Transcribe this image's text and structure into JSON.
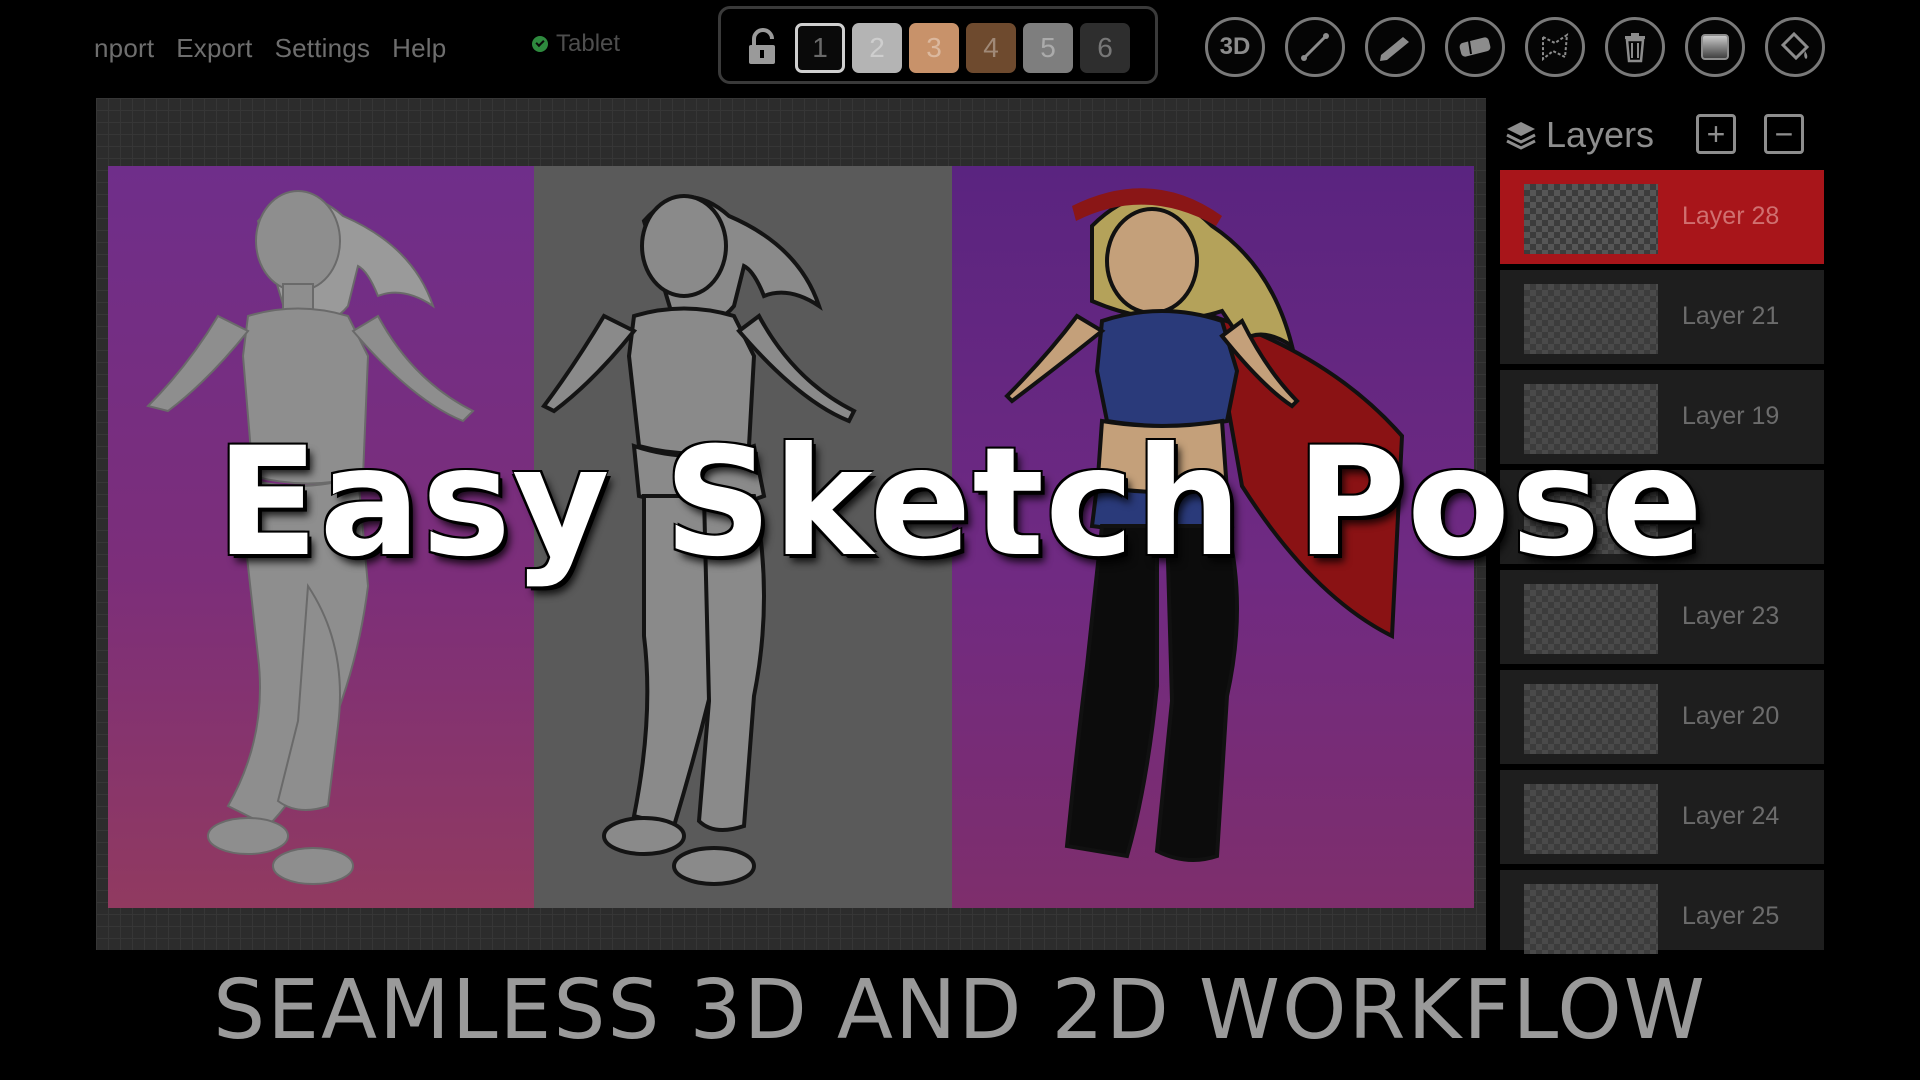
{
  "menu": {
    "items": [
      "nport",
      "Export",
      "Settings",
      "Help"
    ],
    "tablet_status": "Tablet",
    "tablet_color": "#2e8a3e"
  },
  "pose_slots": {
    "lock_icon": "lock-icon",
    "slots": [
      {
        "label": "1",
        "color": "#0a0a0a",
        "selected": true
      },
      {
        "label": "2",
        "color": "#b4b4b4",
        "selected": false
      },
      {
        "label": "3",
        "color": "#c8926a",
        "selected": false
      },
      {
        "label": "4",
        "color": "#6e4a2e",
        "selected": false
      },
      {
        "label": "5",
        "color": "#7e7e7e",
        "selected": false
      },
      {
        "label": "6",
        "color": "#2e2e2e",
        "selected": false
      }
    ]
  },
  "toolbar": {
    "tools": [
      {
        "label": "3D",
        "icon": "3d-mode-icon"
      },
      {
        "label": "",
        "icon": "line-tool-icon"
      },
      {
        "label": "",
        "icon": "pen-tool-icon"
      },
      {
        "label": "",
        "icon": "eraser-tool-icon"
      },
      {
        "label": "",
        "icon": "lasso-select-icon"
      },
      {
        "label": "",
        "icon": "trash-icon"
      },
      {
        "label": "",
        "icon": "gradient-icon"
      },
      {
        "label": "",
        "icon": "fill-bucket-icon"
      }
    ]
  },
  "layers": {
    "title": "Layers",
    "add_label": "+",
    "remove_label": "−",
    "items": [
      {
        "name": "Layer 28",
        "active": true
      },
      {
        "name": "Layer 21",
        "active": false
      },
      {
        "name": "Layer 19",
        "active": false
      },
      {
        "name": "",
        "active": false
      },
      {
        "name": "Layer 23",
        "active": false
      },
      {
        "name": "Layer 20",
        "active": false
      },
      {
        "name": "Layer 24",
        "active": false
      },
      {
        "name": "Layer 25",
        "active": false
      }
    ]
  },
  "overlay": {
    "title": "Easy Sketch Pose",
    "tagline": "SEAMLESS 3D AND 2D WORKFLOW"
  },
  "colors": {
    "accent_red": "#a8151a",
    "panel_purple": "#6f2e8a",
    "panel_gray": "#5a5a5a"
  }
}
